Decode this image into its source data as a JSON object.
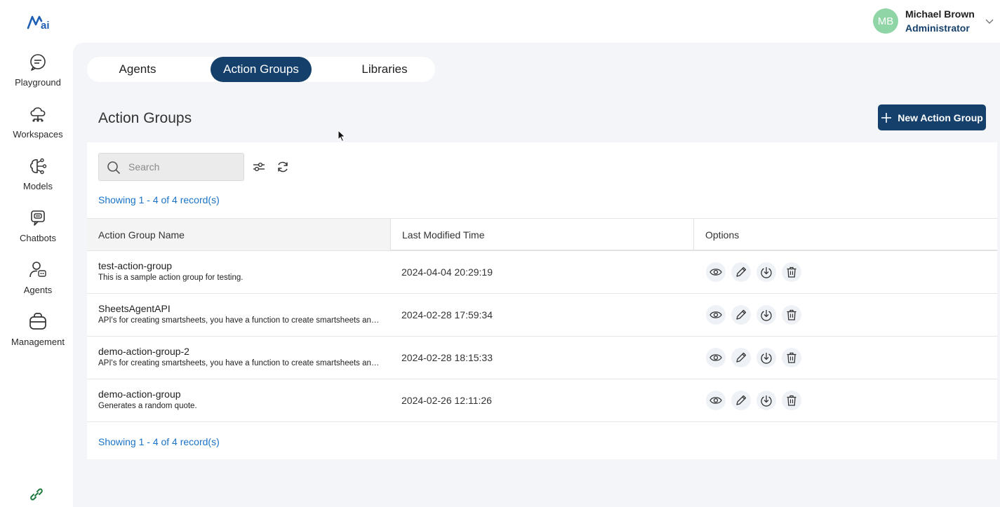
{
  "brand": {
    "logo_text": "ai"
  },
  "sidebar": {
    "items": [
      {
        "label": "Playground"
      },
      {
        "label": "Workspaces"
      },
      {
        "label": "Models"
      },
      {
        "label": "Chatbots"
      },
      {
        "label": "Agents"
      },
      {
        "label": "Management"
      }
    ]
  },
  "user": {
    "initials": "MB",
    "name": "Michael Brown",
    "role": "Administrator"
  },
  "tabs": [
    {
      "label": "Agents",
      "active": false
    },
    {
      "label": "Action Groups",
      "active": true
    },
    {
      "label": "Libraries",
      "active": false
    }
  ],
  "page": {
    "title": "Action Groups",
    "new_button_label": "New Action Group"
  },
  "search": {
    "placeholder": "Search",
    "value": ""
  },
  "records": {
    "top_text": "Showing 1 - 4 of 4 record(s)",
    "bottom_text": "Showing 1 - 4 of 4 record(s)"
  },
  "table": {
    "columns": [
      "Action Group Name",
      "Last Modified Time",
      "Options"
    ],
    "rows": [
      {
        "name": "test-action-group",
        "description": "This is a sample action group for testing.",
        "modified": "2024-04-04 20:29:19"
      },
      {
        "name": "SheetsAgentAPI",
        "description": "API's for creating smartsheets, you have a function to create smartsheets and add rows",
        "modified": "2024-02-28 17:59:34"
      },
      {
        "name": "demo-action-group-2",
        "description": "API's for creating smartsheets, you have a function to create smartsheets and add rows",
        "modified": "2024-02-28 18:15:33"
      },
      {
        "name": "demo-action-group",
        "description": "Generates a random quote.",
        "modified": "2024-02-26 12:11:26"
      }
    ],
    "row_options": [
      "view-icon",
      "edit-icon",
      "download-icon",
      "delete-icon"
    ]
  },
  "colors": {
    "primary": "#15406b",
    "link": "#1a73c7",
    "avatar": "#8fd5a6",
    "panel_bg": "#f4f5f9"
  }
}
